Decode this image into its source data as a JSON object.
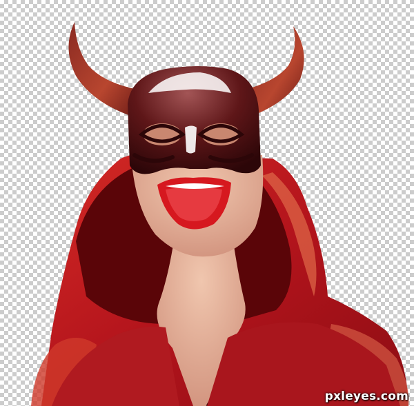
{
  "image": {
    "background": "transparency-checkerboard",
    "subject_icon": "devil-mask-portrait-icon"
  },
  "watermark": {
    "text": "pxleyes.com"
  },
  "colors": {
    "hood": "#b3141c",
    "hood_dark": "#5a0508",
    "horn": "#a8322a",
    "mask": "#5a1416",
    "skin": "#e7b29a",
    "mouth": "#d6181f"
  }
}
